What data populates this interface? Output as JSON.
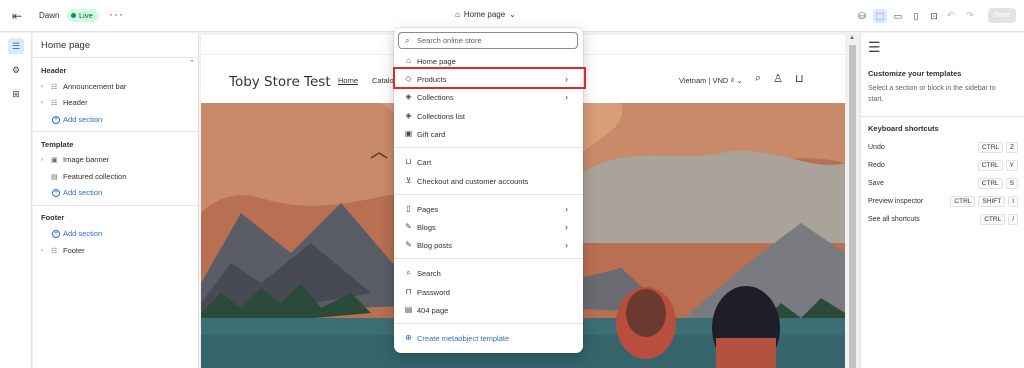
{
  "topbar": {
    "exit_icon": "exit-icon",
    "theme_name": "Dawn",
    "live_badge": "Live",
    "more_icon": "more-icon",
    "page_selector": "Home page",
    "page_selector_icon": "home-icon",
    "tools": [
      "theme-settings-icon",
      "inspector-icon",
      "desktop-view-icon",
      "mobile-view-icon",
      "fullscreen-icon"
    ],
    "undo_icon": "undo-icon",
    "redo_icon": "redo-icon",
    "save_label": "Save"
  },
  "left_rail": [
    "sections-icon",
    "settings-icon",
    "apps-icon"
  ],
  "sidebar": {
    "title": "Home page",
    "groups": [
      {
        "label": "Header",
        "items": [
          {
            "label": "Announcement bar",
            "icon": "announcement-icon",
            "expandable": true
          },
          {
            "label": "Header",
            "icon": "header-icon",
            "expandable": true
          }
        ],
        "add_label": "Add section"
      },
      {
        "label": "Template",
        "items": [
          {
            "label": "Image banner",
            "icon": "image-banner-icon",
            "expandable": true
          },
          {
            "label": "Featured collection",
            "icon": "collection-icon",
            "expandable": false
          }
        ],
        "add_label": "Add section"
      },
      {
        "label": "Footer",
        "add_label": "Add section",
        "items": [
          {
            "label": "Footer",
            "icon": "footer-icon",
            "expandable": true
          }
        ]
      }
    ]
  },
  "preview": {
    "store_name": "Toby Store Test",
    "nav": [
      "Home",
      "Catalog"
    ],
    "locale": "Vietnam | VND ₫",
    "icons": [
      "search-icon",
      "account-icon",
      "cart-icon"
    ]
  },
  "dropdown": {
    "search_placeholder": "Search online store",
    "items": [
      {
        "label": "Home page",
        "icon": "home-icon",
        "submenu": false
      },
      {
        "label": "Products",
        "icon": "tag-icon",
        "submenu": true,
        "highlighted": true
      },
      {
        "label": "Collections",
        "icon": "collections-icon",
        "submenu": true
      },
      {
        "label": "Collections list",
        "icon": "collections-list-icon",
        "submenu": false
      },
      {
        "label": "Gift card",
        "icon": "gift-card-icon",
        "submenu": false
      },
      {
        "label": "Cart",
        "icon": "cart-icon",
        "submenu": false
      },
      {
        "label": "Checkout and customer accounts",
        "icon": "checkout-icon",
        "submenu": false
      },
      {
        "label": "Pages",
        "icon": "page-icon",
        "submenu": true
      },
      {
        "label": "Blogs",
        "icon": "blog-icon",
        "submenu": true
      },
      {
        "label": "Blog posts",
        "icon": "blog-post-icon",
        "submenu": true
      },
      {
        "label": "Search",
        "icon": "search-icon",
        "submenu": false
      },
      {
        "label": "Password",
        "icon": "lock-icon",
        "submenu": false
      },
      {
        "label": "404 page",
        "icon": "error-page-icon",
        "submenu": false
      }
    ],
    "create_link": {
      "label": "Create metaobject template",
      "icon": "add-circle-icon"
    }
  },
  "right_panel": {
    "icon": "template-icon",
    "title": "Customize your templates",
    "description": "Select a section or block in the sidebar to start.",
    "shortcuts_title": "Keyboard shortcuts",
    "shortcuts": [
      {
        "label": "Undo",
        "keys": [
          "CTRL",
          "Z"
        ]
      },
      {
        "label": "Redo",
        "keys": [
          "CTRL",
          "Y"
        ]
      },
      {
        "label": "Save",
        "keys": [
          "CTRL",
          "S"
        ]
      },
      {
        "label": "Preview inspector",
        "keys": [
          "CTRL",
          "SHIFT",
          "I"
        ]
      },
      {
        "label": "See all shortcuts",
        "keys": [
          "CTRL",
          "/"
        ]
      }
    ]
  },
  "colors": {
    "accent": "#2c6ecb",
    "highlight_border": "#d72c2c",
    "live_badge_bg": "#cdfee1"
  }
}
